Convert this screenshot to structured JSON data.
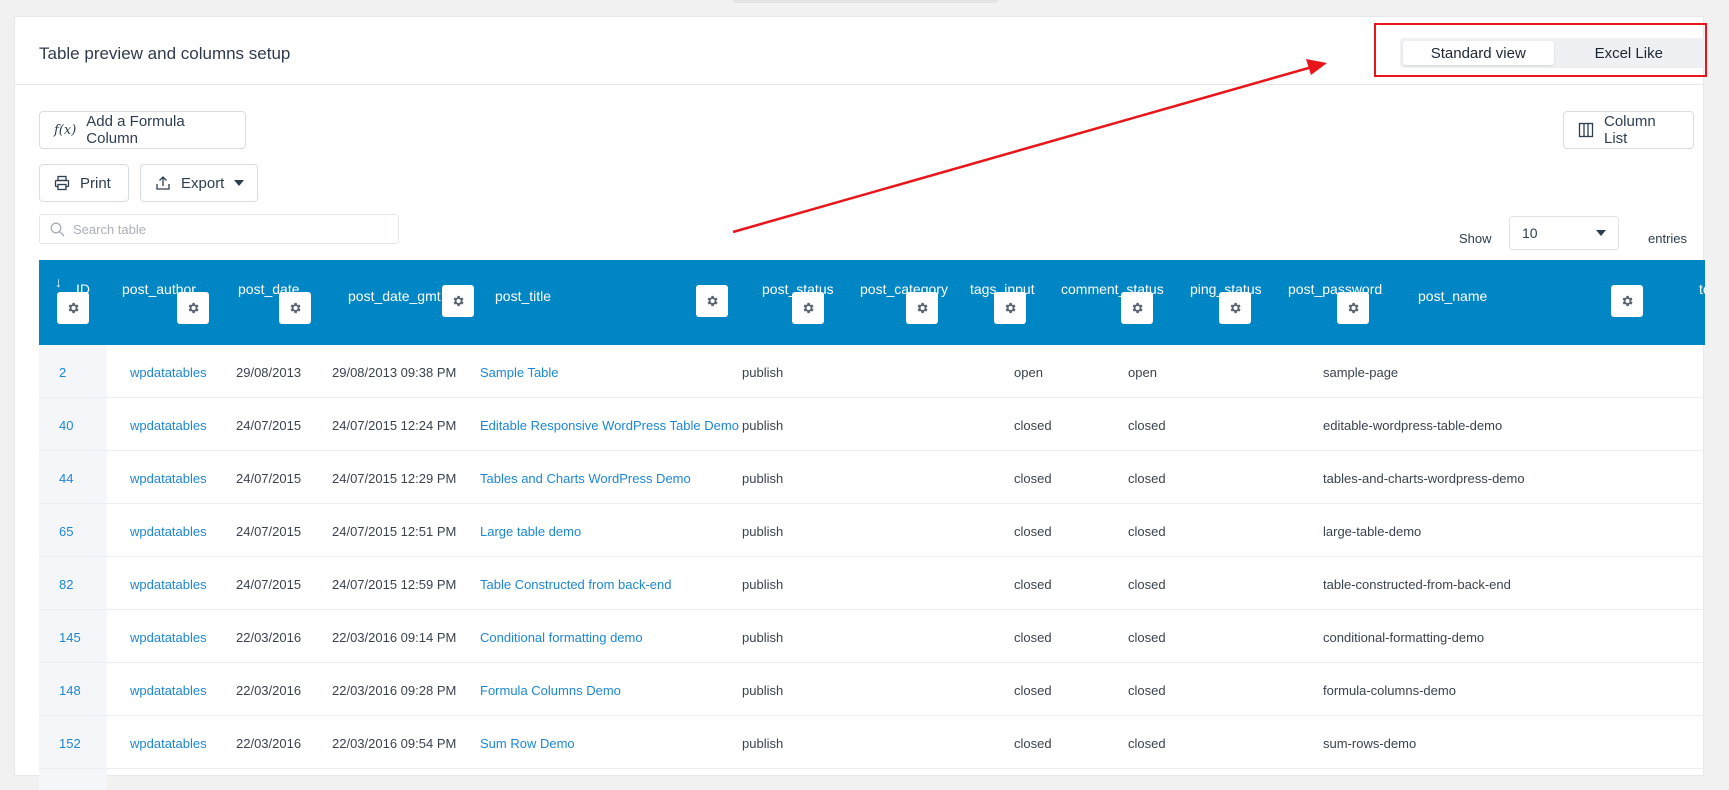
{
  "panel": {
    "title": "Table preview and columns setup",
    "view_toggle": {
      "standard": "Standard view",
      "excel": "Excel Like",
      "active": "standard"
    }
  },
  "toolbar": {
    "formula_label": "Add a Formula Column",
    "column_list_label": "Column List",
    "print_label": "Print",
    "export_label": "Export"
  },
  "search": {
    "placeholder": "Search table",
    "value": ""
  },
  "pagination": {
    "show_label": "Show",
    "entries_value": "10",
    "entries_label": "entries"
  },
  "table": {
    "header_color": "#0086c5",
    "columns": [
      "ID",
      "post_author",
      "post_date",
      "post_date_gmt",
      "post_title",
      "post_status",
      "post_category",
      "tags_input",
      "comment_status",
      "ping_status",
      "post_password",
      "post_name",
      "to"
    ],
    "sort_icon": "sort-down-arrow-icon",
    "rows": [
      {
        "id": "2",
        "author": "wpdatatables",
        "date": "29/08/2013",
        "date_gmt": "29/08/2013 09:38 PM",
        "title": "Sample Table",
        "status": "publish",
        "comment": "open",
        "ping": "open",
        "name": "sample-page"
      },
      {
        "id": "40",
        "author": "wpdatatables",
        "date": "24/07/2015",
        "date_gmt": "24/07/2015 12:24 PM",
        "title": "Editable Responsive WordPress Table Demo",
        "status": "publish",
        "comment": "closed",
        "ping": "closed",
        "name": "editable-wordpress-table-demo"
      },
      {
        "id": "44",
        "author": "wpdatatables",
        "date": "24/07/2015",
        "date_gmt": "24/07/2015 12:29 PM",
        "title": "Tables and Charts WordPress Demo",
        "status": "publish",
        "comment": "closed",
        "ping": "closed",
        "name": "tables-and-charts-wordpress-demo"
      },
      {
        "id": "65",
        "author": "wpdatatables",
        "date": "24/07/2015",
        "date_gmt": "24/07/2015 12:51 PM",
        "title": "Large table demo",
        "status": "publish",
        "comment": "closed",
        "ping": "closed",
        "name": "large-table-demo"
      },
      {
        "id": "82",
        "author": "wpdatatables",
        "date": "24/07/2015",
        "date_gmt": "24/07/2015 12:59 PM",
        "title": "Table Constructed from back-end",
        "status": "publish",
        "comment": "closed",
        "ping": "closed",
        "name": "table-constructed-from-back-end"
      },
      {
        "id": "145",
        "author": "wpdatatables",
        "date": "22/03/2016",
        "date_gmt": "22/03/2016 09:14 PM",
        "title": "Conditional formatting demo",
        "status": "publish",
        "comment": "closed",
        "ping": "closed",
        "name": "conditional-formatting-demo"
      },
      {
        "id": "148",
        "author": "wpdatatables",
        "date": "22/03/2016",
        "date_gmt": "22/03/2016 09:28 PM",
        "title": "Formula Columns Demo",
        "status": "publish",
        "comment": "closed",
        "ping": "closed",
        "name": "formula-columns-demo"
      },
      {
        "id": "152",
        "author": "wpdatatables",
        "date": "22/03/2016",
        "date_gmt": "22/03/2016 09:54 PM",
        "title": "Sum Row Demo",
        "status": "publish",
        "comment": "closed",
        "ping": "closed",
        "name": "sum-rows-demo"
      }
    ]
  },
  "annotation": {
    "color": "#e8161b"
  }
}
